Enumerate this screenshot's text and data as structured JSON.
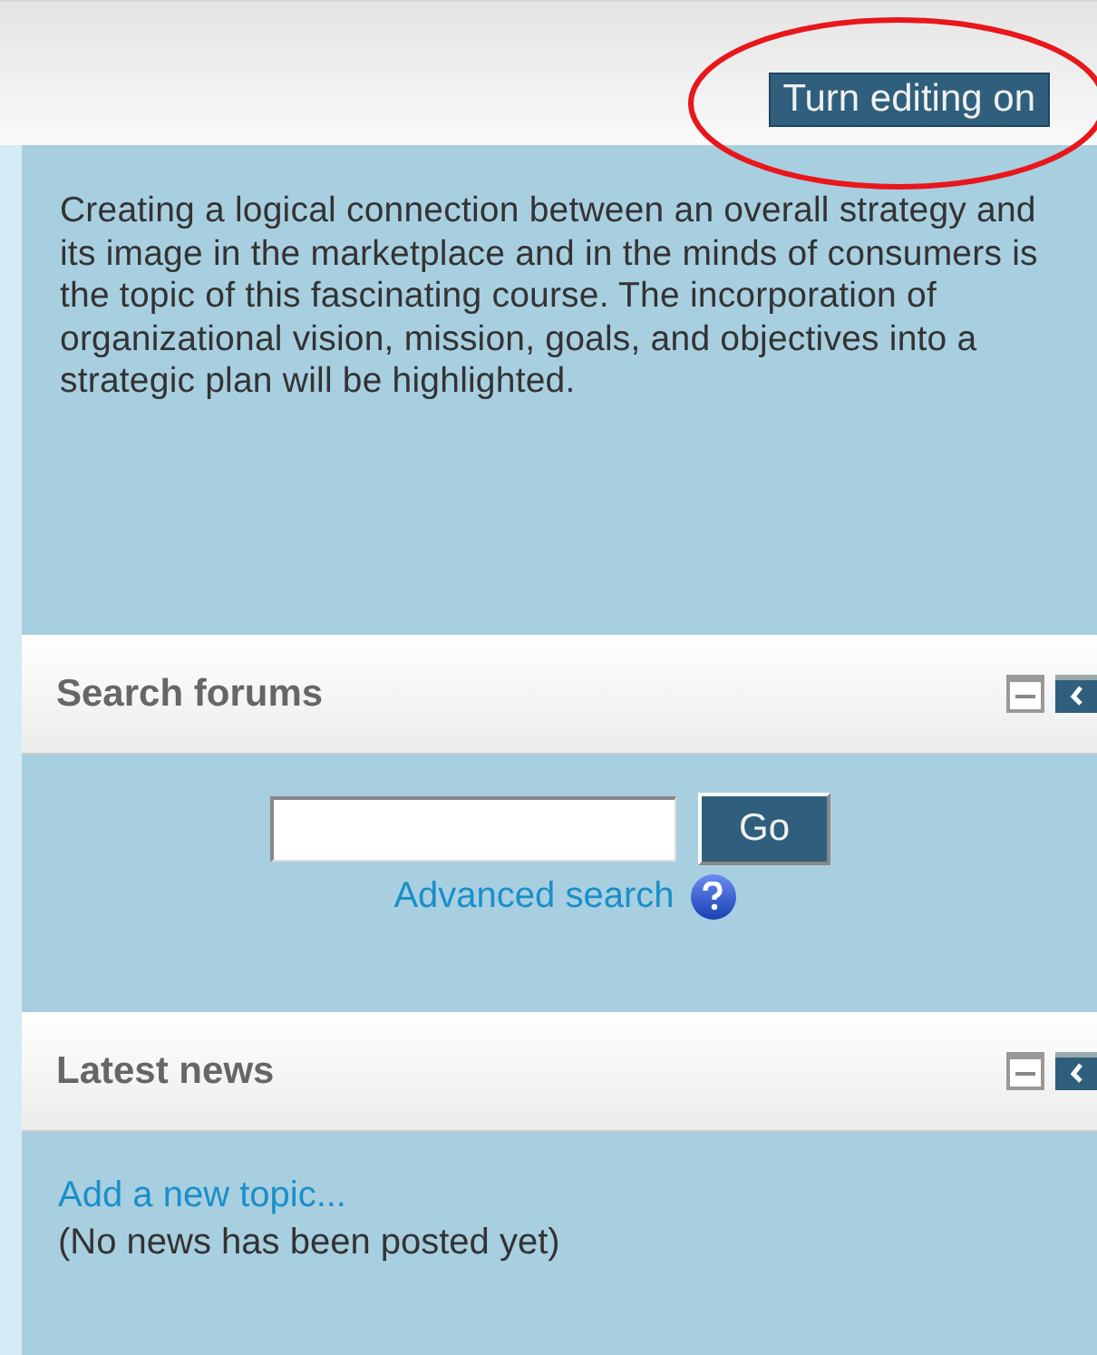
{
  "top_bar": {
    "button": "Turn editing on",
    "highlighted": true
  },
  "summary": "Creating a logical connection between an overall strategy and its image in the marketplace and in the minds of consumers is the topic of this fascinating course. The incorporation of organizational vision, mission, goals, and objectives into a strategic plan will be highlighted.",
  "blocks": [
    {
      "kind": "search",
      "title": "Search forums",
      "button": "Go",
      "link": "Advanced search"
    },
    {
      "kind": "news",
      "title": "Latest news",
      "link": "Add a new topic...",
      "note": "(No news has been posted yet)"
    }
  ]
}
